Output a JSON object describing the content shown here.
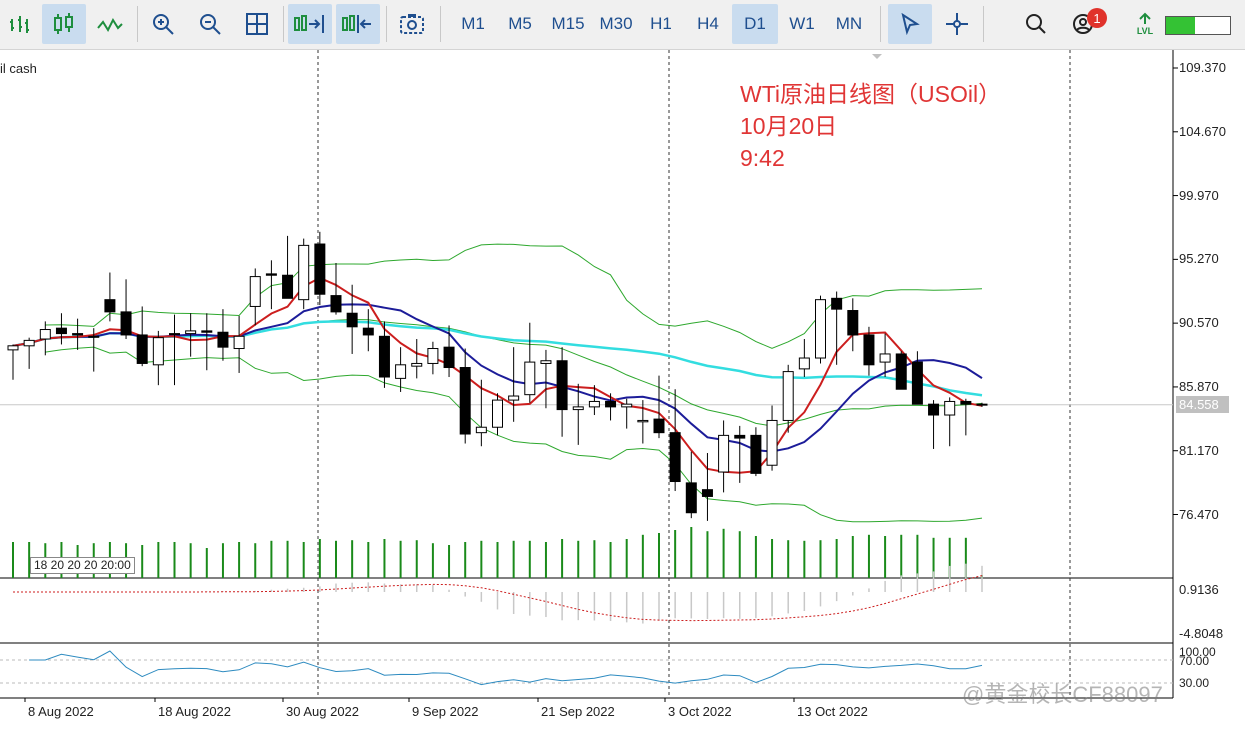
{
  "toolbar": {
    "timeframes": [
      "M1",
      "M5",
      "M15",
      "M30",
      "H1",
      "H4",
      "D1",
      "W1",
      "MN"
    ],
    "active_timeframe": "D1",
    "notification_count": "1",
    "lvl_label": "LVL"
  },
  "chart": {
    "symbol_label": "il cash",
    "annotation_title": "WTi原油日线图（USOil）",
    "annotation_date": "10月20日",
    "annotation_time": "9:42",
    "current_price": "84.558",
    "price_labels": [
      "109.370",
      "104.670",
      "99.970",
      "95.270",
      "90.570",
      "85.870",
      "81.170",
      "76.470"
    ],
    "date_labels": [
      "8 Aug 2022",
      "18 Aug 2022",
      "30 Aug 2022",
      "9 Sep 2022",
      "21 Sep 2022",
      "3 Oct 2022",
      "13 Oct 2022"
    ],
    "volume_label": "18 20 20 20 20:00",
    "macd_labels": [
      "0.9136",
      "-4.8048"
    ],
    "rsi_labels": [
      "100.00",
      "70.00",
      "30.00"
    ],
    "watermark": "@黄金校长CF88097",
    "colors": {
      "up": "#ffffff",
      "down": "#000000",
      "ma_red": "#cc1e1e",
      "ma_blue": "#1c1c99",
      "ma_cyan": "#33dde0",
      "bands": "#2ea82e",
      "volume": "#1a8a1a"
    }
  },
  "chart_data": {
    "type": "candlestick",
    "title": "WTi原油日线图（USOil）",
    "dates": [
      "2022-07-28",
      "2022-07-29",
      "2022-08-01",
      "2022-08-02",
      "2022-08-03",
      "2022-08-04",
      "2022-08-05",
      "2022-08-08",
      "2022-08-09",
      "2022-08-10",
      "2022-08-11",
      "2022-08-12",
      "2022-08-15",
      "2022-08-16",
      "2022-08-17",
      "2022-08-18",
      "2022-08-19",
      "2022-08-22",
      "2022-08-23",
      "2022-08-24",
      "2022-08-25",
      "2022-08-26",
      "2022-08-29",
      "2022-08-30",
      "2022-08-31",
      "2022-09-01",
      "2022-09-02",
      "2022-09-05",
      "2022-09-06",
      "2022-09-07",
      "2022-09-08",
      "2022-09-09",
      "2022-09-12",
      "2022-09-13",
      "2022-09-14",
      "2022-09-15",
      "2022-09-16",
      "2022-09-19",
      "2022-09-20",
      "2022-09-21",
      "2022-09-22",
      "2022-09-23",
      "2022-09-26",
      "2022-09-27",
      "2022-09-28",
      "2022-09-29",
      "2022-09-30",
      "2022-10-03",
      "2022-10-04",
      "2022-10-05",
      "2022-10-06",
      "2022-10-07",
      "2022-10-10",
      "2022-10-11",
      "2022-10-12",
      "2022-10-13",
      "2022-10-14",
      "2022-10-17",
      "2022-10-18",
      "2022-10-19",
      "2022-10-20"
    ],
    "open": [
      88.6,
      88.9,
      89.4,
      90.2,
      89.8,
      89.6,
      92.3,
      91.4,
      89.7,
      87.5,
      89.8,
      89.8,
      90.0,
      89.9,
      88.7,
      91.8,
      94.2,
      94.1,
      92.3,
      96.4,
      92.6,
      91.3,
      90.2,
      89.6,
      86.5,
      87.4,
      87.6,
      88.8,
      87.3,
      82.5,
      82.9,
      84.9,
      85.3,
      87.6,
      87.8,
      84.2,
      84.4,
      84.8,
      84.4,
      83.3,
      83.5,
      82.5,
      78.8,
      78.3,
      79.6,
      82.3,
      82.3,
      80.1,
      83.4,
      87.2,
      88.0,
      92.4,
      91.5,
      89.7,
      87.7,
      88.3,
      87.7,
      84.6,
      83.8,
      84.8,
      84.6
    ],
    "high": [
      89.0,
      89.5,
      90.7,
      91.3,
      90.9,
      90.2,
      94.3,
      93.8,
      91.8,
      90.0,
      91.2,
      91.3,
      91.3,
      91.6,
      91.1,
      94.6,
      95.2,
      97.0,
      96.8,
      97.3,
      95.0,
      93.4,
      91.6,
      90.7,
      88.8,
      89.4,
      89.2,
      90.4,
      88.7,
      86.4,
      85.4,
      88.8,
      90.6,
      88.6,
      88.8,
      86.1,
      86.0,
      85.4,
      85.0,
      84.9,
      86.7,
      85.7,
      81.1,
      81.0,
      83.4,
      83.0,
      82.9,
      84.5,
      87.5,
      89.4,
      92.6,
      92.9,
      92.4,
      90.3,
      89.8,
      88.5,
      88.5,
      84.9,
      85.1,
      85.0,
      84.7
    ],
    "low": [
      86.4,
      87.2,
      88.2,
      89.0,
      88.6,
      87.0,
      90.7,
      89.4,
      87.4,
      86.0,
      86.0,
      88.1,
      87.1,
      87.8,
      86.9,
      90.4,
      91.6,
      93.6,
      91.6,
      91.9,
      91.2,
      88.3,
      88.5,
      85.8,
      85.5,
      86.5,
      86.8,
      86.6,
      81.7,
      81.5,
      82.3,
      83.3,
      84.7,
      84.3,
      82.2,
      81.6,
      83.8,
      83.4,
      82.8,
      81.7,
      82.1,
      78.2,
      76.2,
      76.0,
      78.1,
      78.8,
      79.3,
      79.7,
      82.5,
      86.6,
      87.6,
      87.5,
      88.5,
      86.7,
      86.6,
      86.0,
      86.3,
      81.3,
      81.5,
      82.3,
      84.4
    ],
    "close": [
      88.9,
      89.3,
      90.1,
      89.8,
      89.7,
      89.6,
      91.4,
      89.7,
      87.6,
      89.5,
      89.8,
      90.0,
      89.9,
      88.8,
      89.6,
      94.0,
      94.1,
      92.4,
      96.3,
      92.7,
      91.4,
      90.3,
      89.7,
      86.6,
      87.5,
      87.6,
      88.7,
      87.3,
      82.4,
      82.9,
      84.9,
      85.2,
      87.7,
      87.8,
      84.2,
      84.4,
      84.8,
      84.4,
      84.6,
      83.4,
      82.5,
      78.9,
      76.6,
      77.8,
      82.3,
      82.1,
      79.5,
      83.4,
      87.0,
      88.0,
      92.3,
      91.6,
      89.7,
      87.5,
      88.3,
      85.7,
      84.6,
      83.8,
      84.8,
      84.6,
      84.6
    ],
    "volume": [
      0.6,
      0.6,
      0.58,
      0.6,
      0.55,
      0.58,
      0.6,
      0.58,
      0.55,
      0.6,
      0.6,
      0.58,
      0.5,
      0.58,
      0.6,
      0.58,
      0.62,
      0.62,
      0.6,
      0.65,
      0.62,
      0.63,
      0.6,
      0.65,
      0.62,
      0.63,
      0.58,
      0.55,
      0.6,
      0.62,
      0.6,
      0.62,
      0.62,
      0.6,
      0.65,
      0.62,
      0.63,
      0.6,
      0.65,
      0.72,
      0.75,
      0.8,
      0.85,
      0.78,
      0.82,
      0.78,
      0.7,
      0.65,
      0.63,
      0.62,
      0.63,
      0.65,
      0.7,
      0.72,
      0.7,
      0.72,
      0.72,
      0.67,
      0.67,
      0.67,
      0.05
    ],
    "ylim": [
      74.7,
      111.0
    ],
    "price_axis": [
      109.37,
      104.67,
      99.97,
      95.27,
      90.57,
      85.87,
      81.17,
      76.47
    ],
    "x_ticks": [
      "8 Aug 2022",
      "18 Aug 2022",
      "30 Aug 2022",
      "9 Sep 2022",
      "21 Sep 2022",
      "3 Oct 2022",
      "13 Oct 2022"
    ],
    "last_price": 84.558
  }
}
